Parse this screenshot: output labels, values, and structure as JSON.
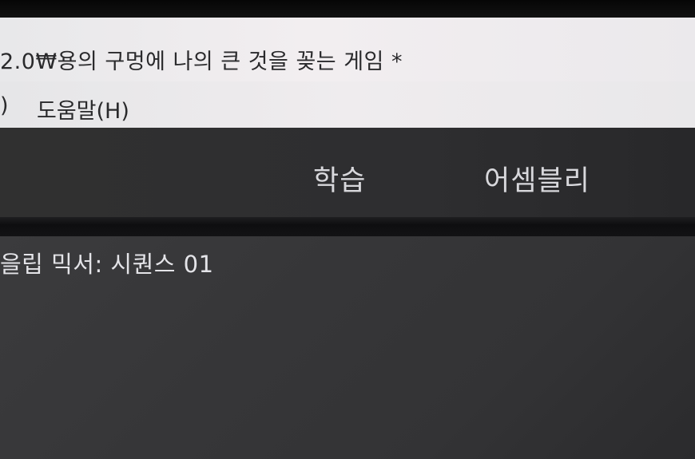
{
  "window": {
    "title": "2.0₩용의 구멍에 나의 큰 것을 꽂는 게임 *"
  },
  "menu": {
    "items": [
      ")",
      "도움말(H)"
    ]
  },
  "nav": {
    "items": [
      "학습",
      "어셈블리"
    ]
  },
  "main": {
    "title": "을립 믹서: 시퀀스 01"
  }
}
